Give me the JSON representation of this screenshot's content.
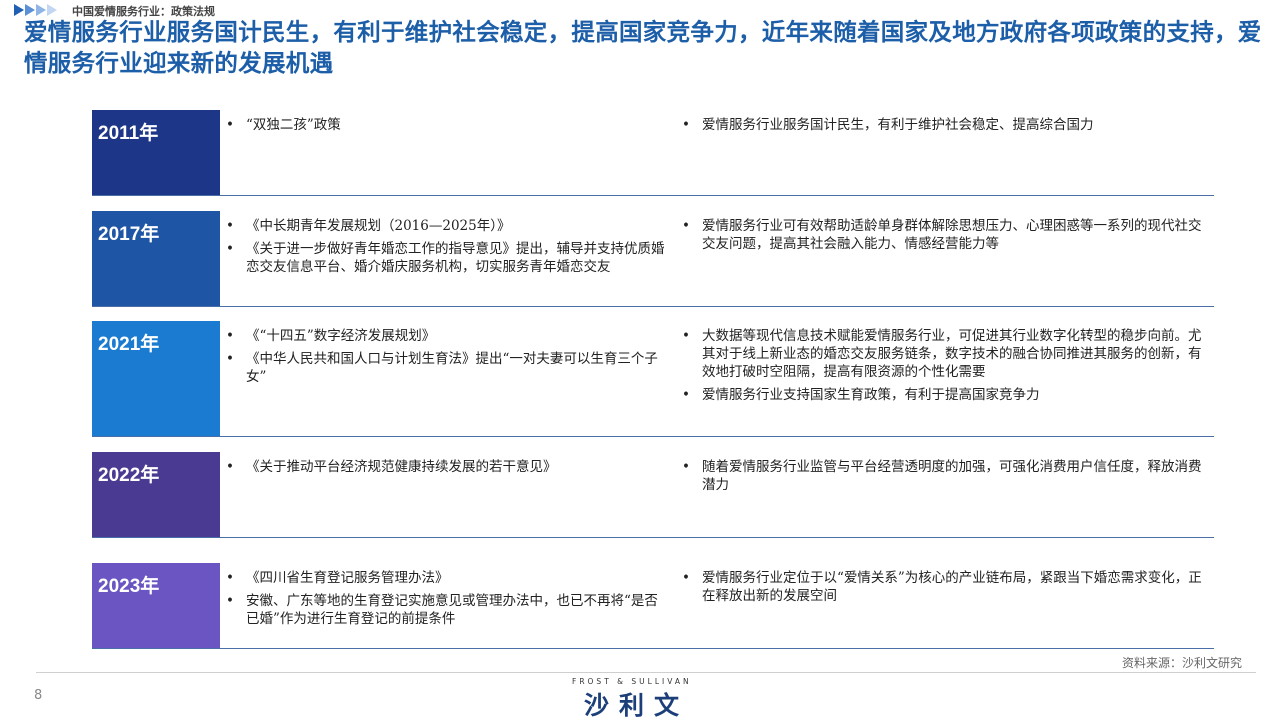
{
  "header": {
    "breadcrumb": "中国爱情服务行业：政策法规",
    "title": "爱情服务行业服务国计民生，有利于维护社会稳定，提高国家竞争力，近年来随着国家及地方政府各项政策的支持，爱情服务行业迎来新的发展机遇"
  },
  "timeline": [
    {
      "year": "2011年",
      "color": "#1e3687",
      "policies": [
        "“双独二孩”政策"
      ],
      "impacts": [
        "爱情服务行业服务国计民生，有利于维护社会稳定、提高综合国力"
      ]
    },
    {
      "year": "2017年",
      "color": "#1f55a5",
      "policies": [
        "《中长期青年发展规划（2016—2025年）》",
        "《关于进一步做好青年婚恋工作的指导意见》提出，辅导并支持优质婚恋交友信息平台、婚介婚庆服务机构，切实服务青年婚恋交友"
      ],
      "impacts": [
        "爱情服务行业可有效帮助适龄单身群体解除思想压力、心理困惑等一系列的现代社交交友问题，提高其社会融入能力、情感经营能力等"
      ]
    },
    {
      "year": "2021年",
      "color": "#1a7bd0",
      "policies": [
        "《“十四五”数字经济发展规划》",
        "《中华人民共和国人口与计划生育法》提出“一对夫妻可以生育三个子女”"
      ],
      "impacts": [
        "大数据等现代信息技术赋能爱情服务行业，可促进其行业数字化转型的稳步向前。尤其对于线上新业态的婚恋交友服务链条，数字技术的融合协同推进其服务的创新，有效地打破时空阻隔，提高有限资源的个性化需要",
        "爱情服务行业支持国家生育政策，有利于提高国家竞争力"
      ]
    },
    {
      "year": "2022年",
      "color": "#4b3a92",
      "policies": [
        "《关于推动平台经济规范健康持续发展的若干意见》"
      ],
      "impacts": [
        "随着爱情服务行业监管与平台经营透明度的加强，可强化消费用户信任度，释放消费潜力"
      ]
    },
    {
      "year": "2023年",
      "color": "#6a55c2",
      "policies": [
        "《四川省生育登记服务管理办法》",
        "安徽、广东等地的生育登记实施意见或管理办法中，也已不再将“是否已婚”作为进行生育登记的前提条件"
      ],
      "impacts": [
        "爱情服务行业定位于以“爱情关系”为核心的产业链布局，紧跟当下婚恋需求变化，正在释放出新的发展空间"
      ]
    }
  ],
  "bullet": "•",
  "footer": {
    "source": "资料来源：沙利文研究",
    "page_number": "8",
    "brand_en": "FROST & SULLIVAN",
    "brand_cn": "沙利文"
  }
}
